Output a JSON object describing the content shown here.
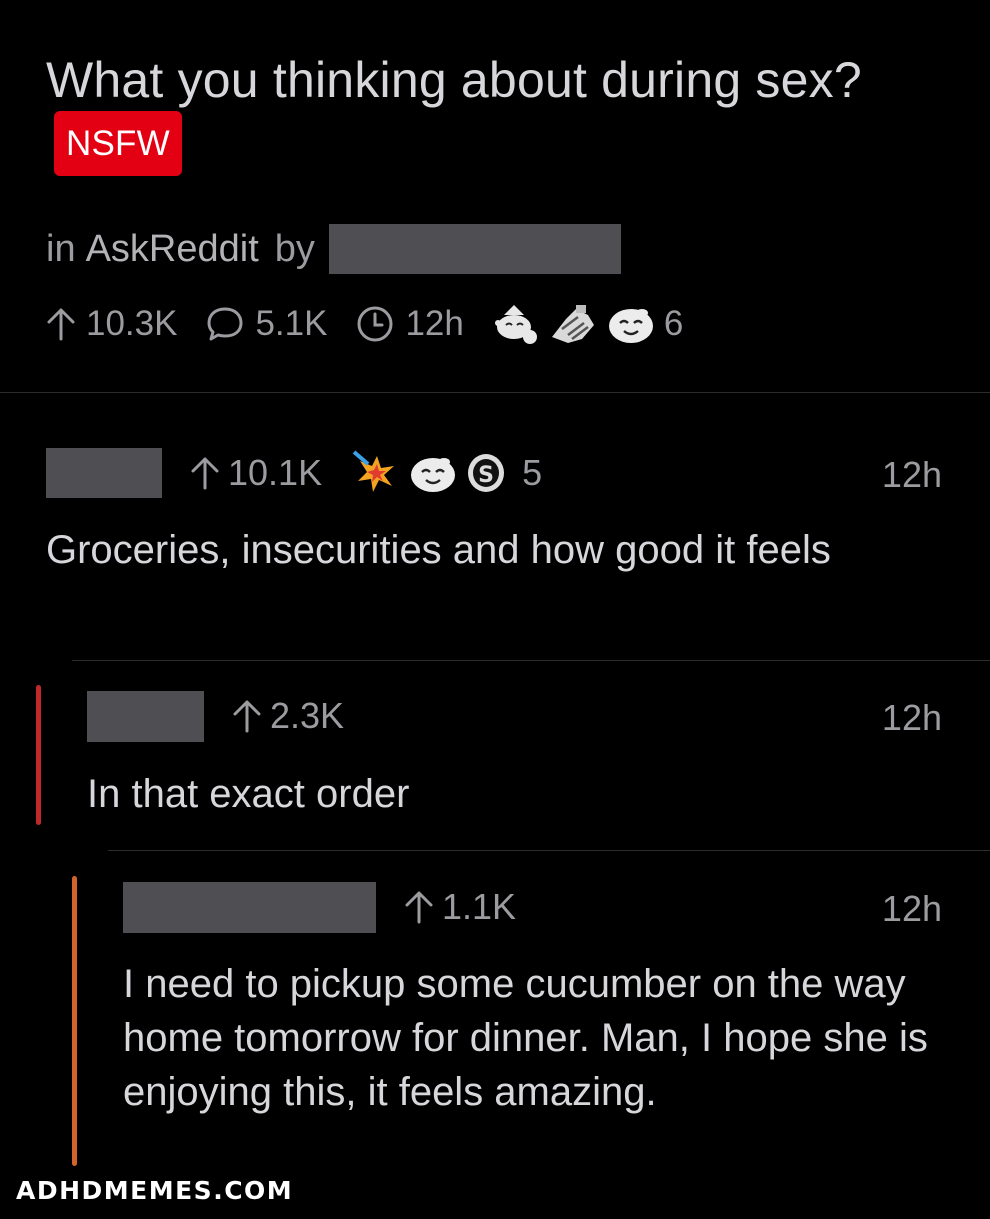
{
  "post": {
    "title": "What you thinking about during sex?",
    "nsfw_label": "NSFW",
    "in_label": "in",
    "subreddit": "AskReddit",
    "by_label": "by",
    "upvotes": "10.3K",
    "comments": "5.1K",
    "age": "12h",
    "award_count": "6"
  },
  "comments": [
    {
      "upvotes": "10.1K",
      "award_count": "5",
      "time": "12h",
      "body": "Groceries, insecurities and how good it feels"
    },
    {
      "upvotes": "2.3K",
      "time": "12h",
      "body": "In that exact order",
      "thread_color": "#c0282b"
    },
    {
      "upvotes": "1.1K",
      "time": "12h",
      "body": "I need to pickup some cucumber on the way home tomorrow for dinner.  Man, I hope she is enjoying this,  it feels amazing.",
      "thread_color": "#d0642a"
    }
  ],
  "watermark": "ADHDMEMES.COM",
  "colors": {
    "background": "#000000",
    "nsfw_badge": "#e30012",
    "text_primary": "#d7d7db",
    "text_secondary": "#9b9ba0",
    "redaction": "#4e4e53"
  },
  "icons": [
    "arrow-up-icon",
    "comment-bubble-icon",
    "clock-icon",
    "award-icon"
  ]
}
